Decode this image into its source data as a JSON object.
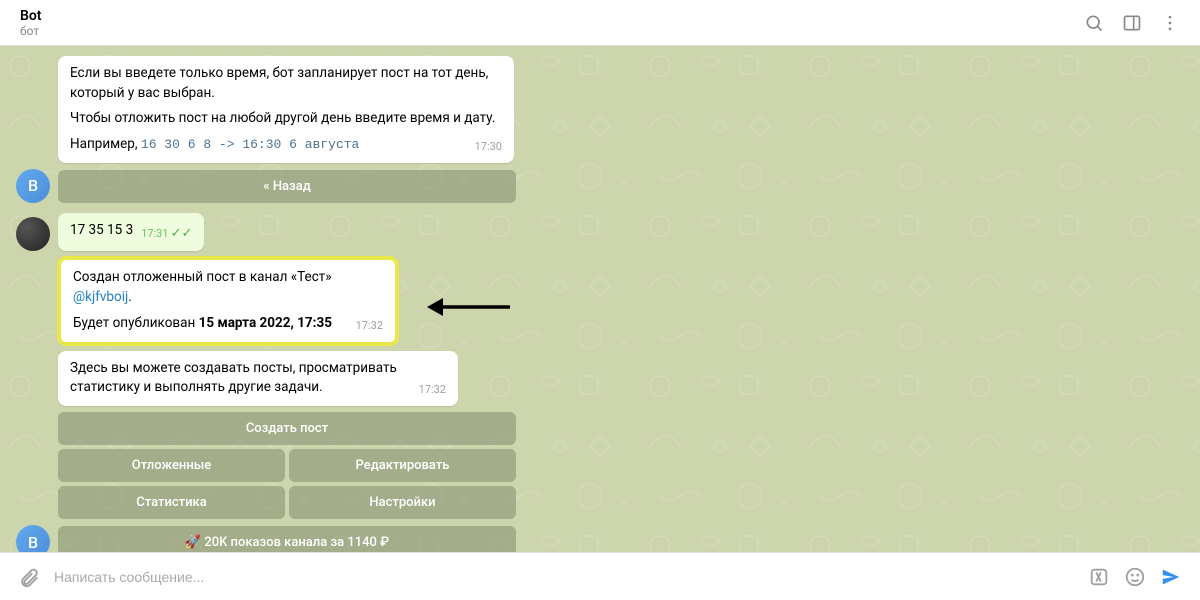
{
  "header": {
    "title": "Bot",
    "subtitle": "бот"
  },
  "messages": {
    "m1": {
      "line1": "Если вы введете только время, бот запланирует пост на тот день, который у вас выбран.",
      "line2": "Чтобы отложить пост на любой другой день введите время и дату.",
      "example_prefix": "Например, ",
      "example_code": "16 30 6 8 -> 16:30 6 августа",
      "time": "17:30"
    },
    "back_btn": "« Назад",
    "m2": {
      "text": "17 35 15 3",
      "time": "17:31"
    },
    "m3": {
      "line1_a": "Создан отложенный пост в канал «Тест» ",
      "mention": "@kjfvboij",
      "line1_b": ".",
      "line2_a": "Будет опубликован ",
      "bold": "15 марта 2022, 17:35",
      "time": "17:32"
    },
    "m4": {
      "text": "Здесь вы можете создавать посты, просматривать статистику и выполнять другие задачи.",
      "time": "17:32"
    },
    "menu": {
      "create": "Создать пост",
      "delayed": "Отложенные",
      "edit": "Редактировать",
      "stats": "Статистика",
      "settings": "Настройки",
      "promo": "🚀 20K показов канала за 1140 ₽"
    }
  },
  "input": {
    "placeholder": "Написать сообщение..."
  },
  "avatars": {
    "bot_letter": "B"
  }
}
